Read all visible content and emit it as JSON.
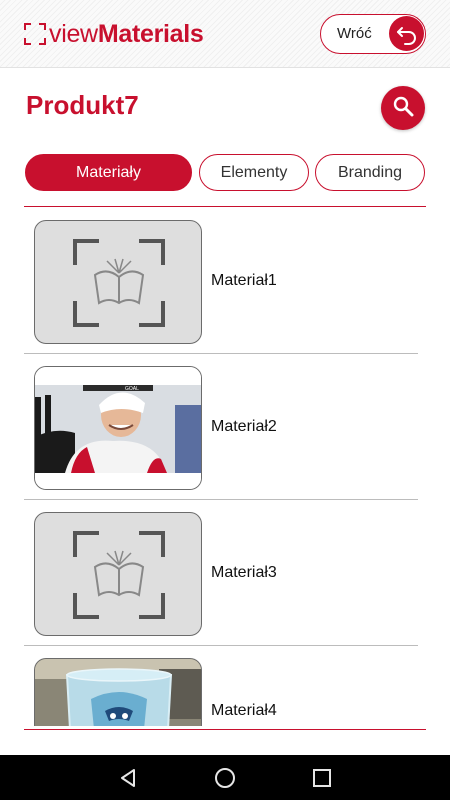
{
  "header": {
    "logo_view": "view",
    "logo_materials": "Materials",
    "back_label": "Wróć"
  },
  "page": {
    "title": "Produkt7"
  },
  "tabs": [
    {
      "label": "Materiały",
      "active": true
    },
    {
      "label": "Elementy",
      "active": false
    },
    {
      "label": "Branding",
      "active": false
    }
  ],
  "items": [
    {
      "label": "Materiał1",
      "thumbnail": "placeholder-book-icon"
    },
    {
      "label": "Materiał2",
      "thumbnail": "hockey-photo"
    },
    {
      "label": "Materiał3",
      "thumbnail": "placeholder-book-icon"
    },
    {
      "label": "Materiał4",
      "thumbnail": "glass-photo"
    }
  ],
  "hockey_overlay_text": "GOAL",
  "colors": {
    "accent": "#c8102e",
    "separator": "#bcbcbc",
    "thumb_bg": "#dedede"
  },
  "navbar": {
    "icons": [
      "back-triangle-icon",
      "home-circle-icon",
      "recents-square-icon"
    ]
  }
}
